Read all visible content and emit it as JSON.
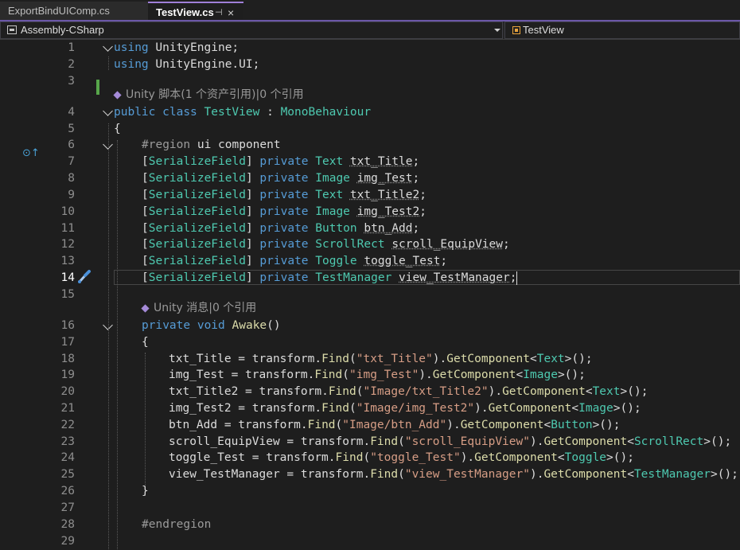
{
  "tabs": [
    {
      "label": "ExportBindUIComp.cs"
    },
    {
      "label": "TestView.cs",
      "active": true,
      "pin": "⊣",
      "close": "×"
    }
  ],
  "nav": {
    "project": "Assembly-CSharp",
    "class": "TestView"
  },
  "lenses": {
    "class_lens": "Unity 脚本(1 个资产引用)|0 个引用",
    "awake_lens": "Unity 消息|0 个引用"
  },
  "line_numbers": [
    "1",
    "2",
    "3",
    "4",
    "5",
    "6",
    "7",
    "8",
    "9",
    "10",
    "11",
    "12",
    "13",
    "14",
    "15",
    "16",
    "17",
    "18",
    "19",
    "20",
    "21",
    "22",
    "23",
    "24",
    "25",
    "26",
    "27",
    "28",
    "29"
  ],
  "current_line": "14",
  "code": {
    "l1a": "using",
    "l1b": "UnityEngine;",
    "l2a": "using",
    "l2b": "UnityEngine.UI;",
    "l4a": "public",
    "l4b": "class",
    "l4c": "TestView",
    "l4d": " : ",
    "l4e": "MonoBehaviour",
    "l5": "{",
    "l6a": "#region",
    "l6b": " ui component",
    "fields": [
      {
        "attr": "SerializeField",
        "kw": "private",
        "type": "Text",
        "name": "txt_Title"
      },
      {
        "attr": "SerializeField",
        "kw": "private",
        "type": "Image",
        "name": "img_Test"
      },
      {
        "attr": "SerializeField",
        "kw": "private",
        "type": "Text",
        "name": "txt_Title2"
      },
      {
        "attr": "SerializeField",
        "kw": "private",
        "type": "Image",
        "name": "img_Test2"
      },
      {
        "attr": "SerializeField",
        "kw": "private",
        "type": "Button",
        "name": "btn_Add"
      },
      {
        "attr": "SerializeField",
        "kw": "private",
        "type": "ScrollRect",
        "name": "scroll_EquipView"
      },
      {
        "attr": "SerializeField",
        "kw": "private",
        "type": "Toggle",
        "name": "toggle_Test"
      },
      {
        "attr": "SerializeField",
        "kw": "private",
        "type": "TestManager",
        "name": "view_TestManager"
      }
    ],
    "l16a": "private",
    "l16b": "void",
    "l16c": "Awake",
    "l16d": "()",
    "l17": "{",
    "assigns": [
      {
        "lhs": "txt_Title",
        "path": "\"txt_Title\"",
        "type": "Text"
      },
      {
        "lhs": "img_Test",
        "path": "\"img_Test\"",
        "type": "Image"
      },
      {
        "lhs": "txt_Title2",
        "path": "\"Image/txt_Title2\"",
        "type": "Text"
      },
      {
        "lhs": "img_Test2",
        "path": "\"Image/img_Test2\"",
        "type": "Image"
      },
      {
        "lhs": "btn_Add",
        "path": "\"Image/btn_Add\"",
        "type": "Button"
      },
      {
        "lhs": "scroll_EquipView",
        "path": "\"scroll_EquipView\"",
        "type": "ScrollRect"
      },
      {
        "lhs": "toggle_Test",
        "path": "\"toggle_Test\"",
        "type": "Toggle"
      },
      {
        "lhs": "view_TestManager",
        "path": "\"view_TestManager\"",
        "type": "TestManager"
      }
    ],
    "eq": " = transform.",
    "find": "Find",
    "getc": "GetComponent",
    "l26": "}",
    "l28": "#endregion"
  },
  "colors": {
    "keyword": "#569cd6",
    "type": "#4ec9b0",
    "method": "#dcdcaa",
    "string": "#d69d85",
    "accent": "#9f7fd8",
    "background": "#1e1e1e"
  },
  "icons": {
    "tab_pin": "pin-icon",
    "tab_close": "close-icon",
    "project": "csharp-project-icon",
    "class": "class-icon",
    "gutter": "implements-icon",
    "brush": "quick-action-brush-icon"
  }
}
